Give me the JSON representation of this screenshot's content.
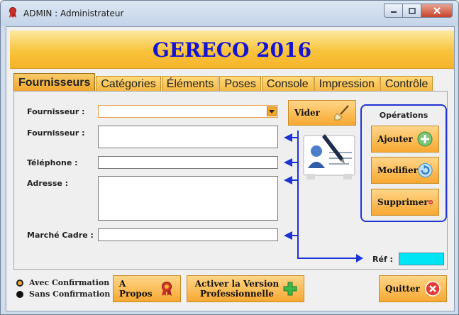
{
  "window": {
    "title": "ADMIN : Administrateur",
    "controls": [
      "minimize",
      "maximize",
      "close"
    ]
  },
  "header": {
    "title": "GERECO 2016"
  },
  "tabs": [
    {
      "label": "Fournisseurs",
      "active": true
    },
    {
      "label": "Catégories",
      "active": false
    },
    {
      "label": "Éléments",
      "active": false
    },
    {
      "label": "Poses",
      "active": false
    },
    {
      "label": "Console",
      "active": false
    },
    {
      "label": "Impression",
      "active": false
    },
    {
      "label": "Contrôle",
      "active": false
    }
  ],
  "form": {
    "fournisseur_select_label": "Fournisseur :",
    "fournisseur_select_value": "",
    "fournisseur_label": "Fournisseur :",
    "fournisseur_value": "",
    "telephone_label": "Téléphone :",
    "telephone_value": "",
    "adresse_label": "Adresse :",
    "adresse_value": "",
    "marche_label": "Marché Cadre :",
    "marche_value": "",
    "ref_label": "Réf :",
    "ref_value": ""
  },
  "buttons": {
    "vider": "Vider",
    "ajouter": "Ajouter",
    "modifier": "Modifier",
    "supprimer": "Supprimer",
    "apropos": "A Propos",
    "activer": "Activer la Version Professionnelle",
    "quitter": "Quitter"
  },
  "operations": {
    "title": "Opérations"
  },
  "confirmation": {
    "avec": "Avec Confirmation",
    "sans": "Sans Confirmation",
    "selected": "avec"
  },
  "colors": {
    "accent_orange": "#f7a832",
    "title_blue": "#1414d2",
    "frame_blue": "#1e33d6",
    "ref_cyan": "#00e5f5"
  },
  "icons": {
    "vider": "broom-icon",
    "ajouter": "plus-icon",
    "modifier": "refresh-icon",
    "supprimer": "minus-icon",
    "apropos": "award-icon",
    "activer": "green-plus-icon",
    "quitter": "close-icon",
    "contact": "contact-card-icon"
  }
}
